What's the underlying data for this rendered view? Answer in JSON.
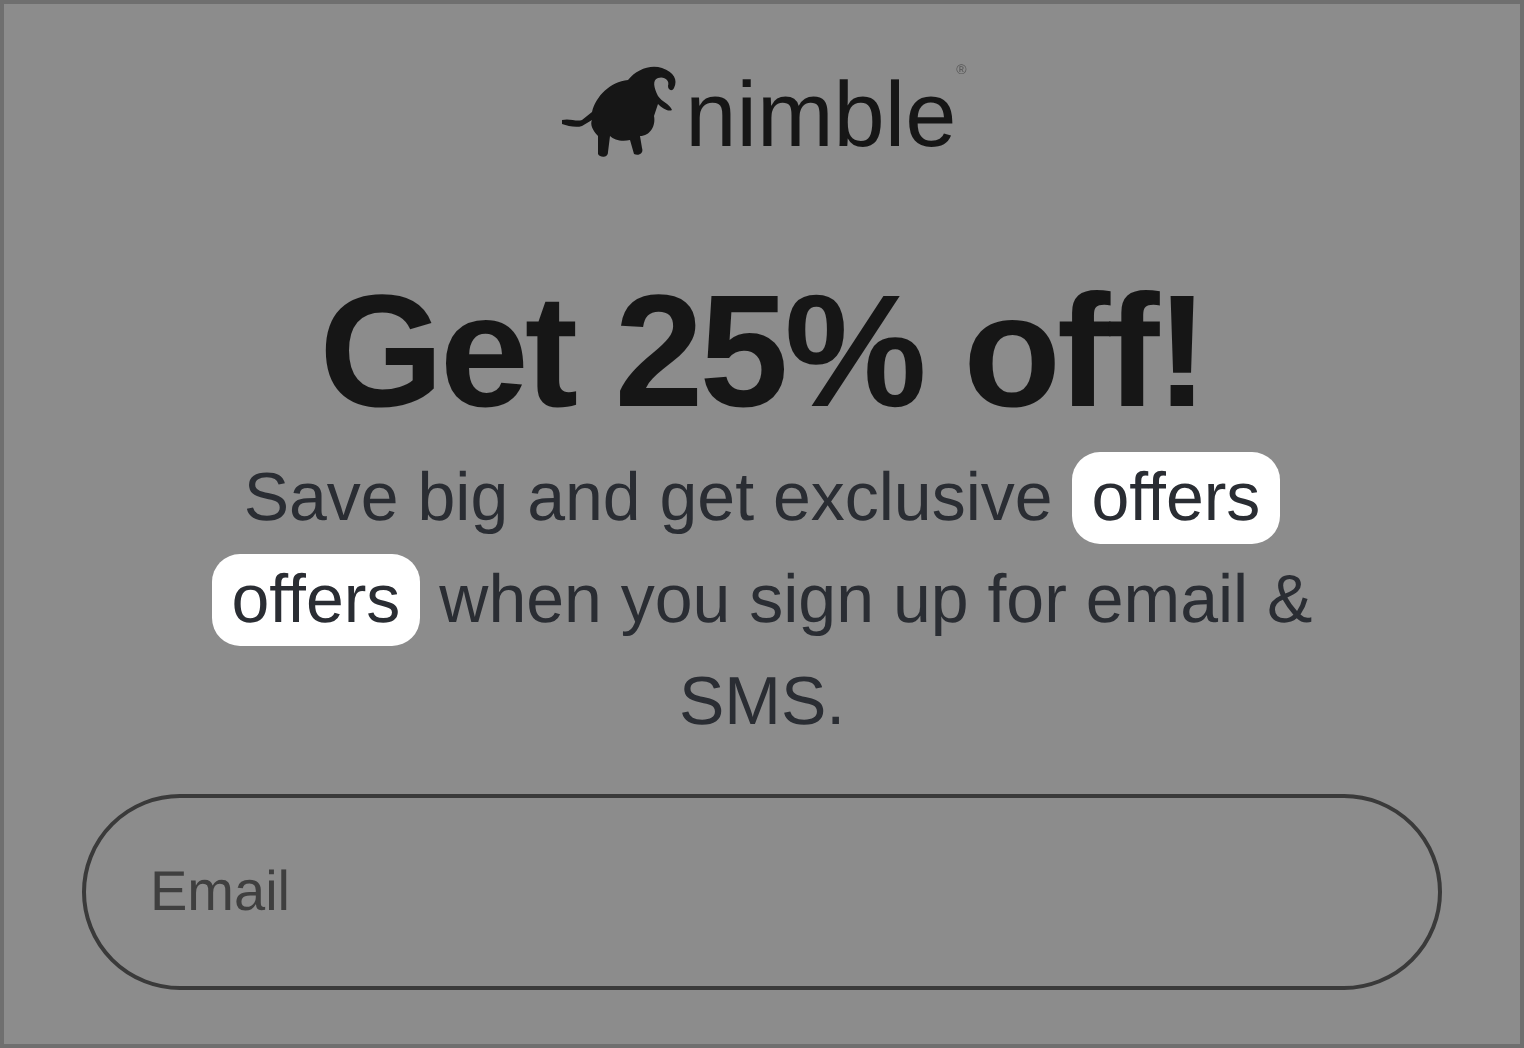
{
  "logo": {
    "text": "nimble",
    "mark": "®"
  },
  "headline": "Get 25% off!",
  "message": {
    "lines": [
      [
        {
          "text": "Save big and get exclusive ",
          "highlight": false
        },
        {
          "text": "offers",
          "highlight": true
        }
      ],
      [
        {
          "text": "offers",
          "highlight": true
        },
        {
          "text": " when you sign up for email &",
          "highlight": false
        }
      ],
      [
        {
          "text": "SMS.",
          "highlight": false
        }
      ]
    ]
  },
  "email_field": {
    "placeholder": "Email"
  }
}
